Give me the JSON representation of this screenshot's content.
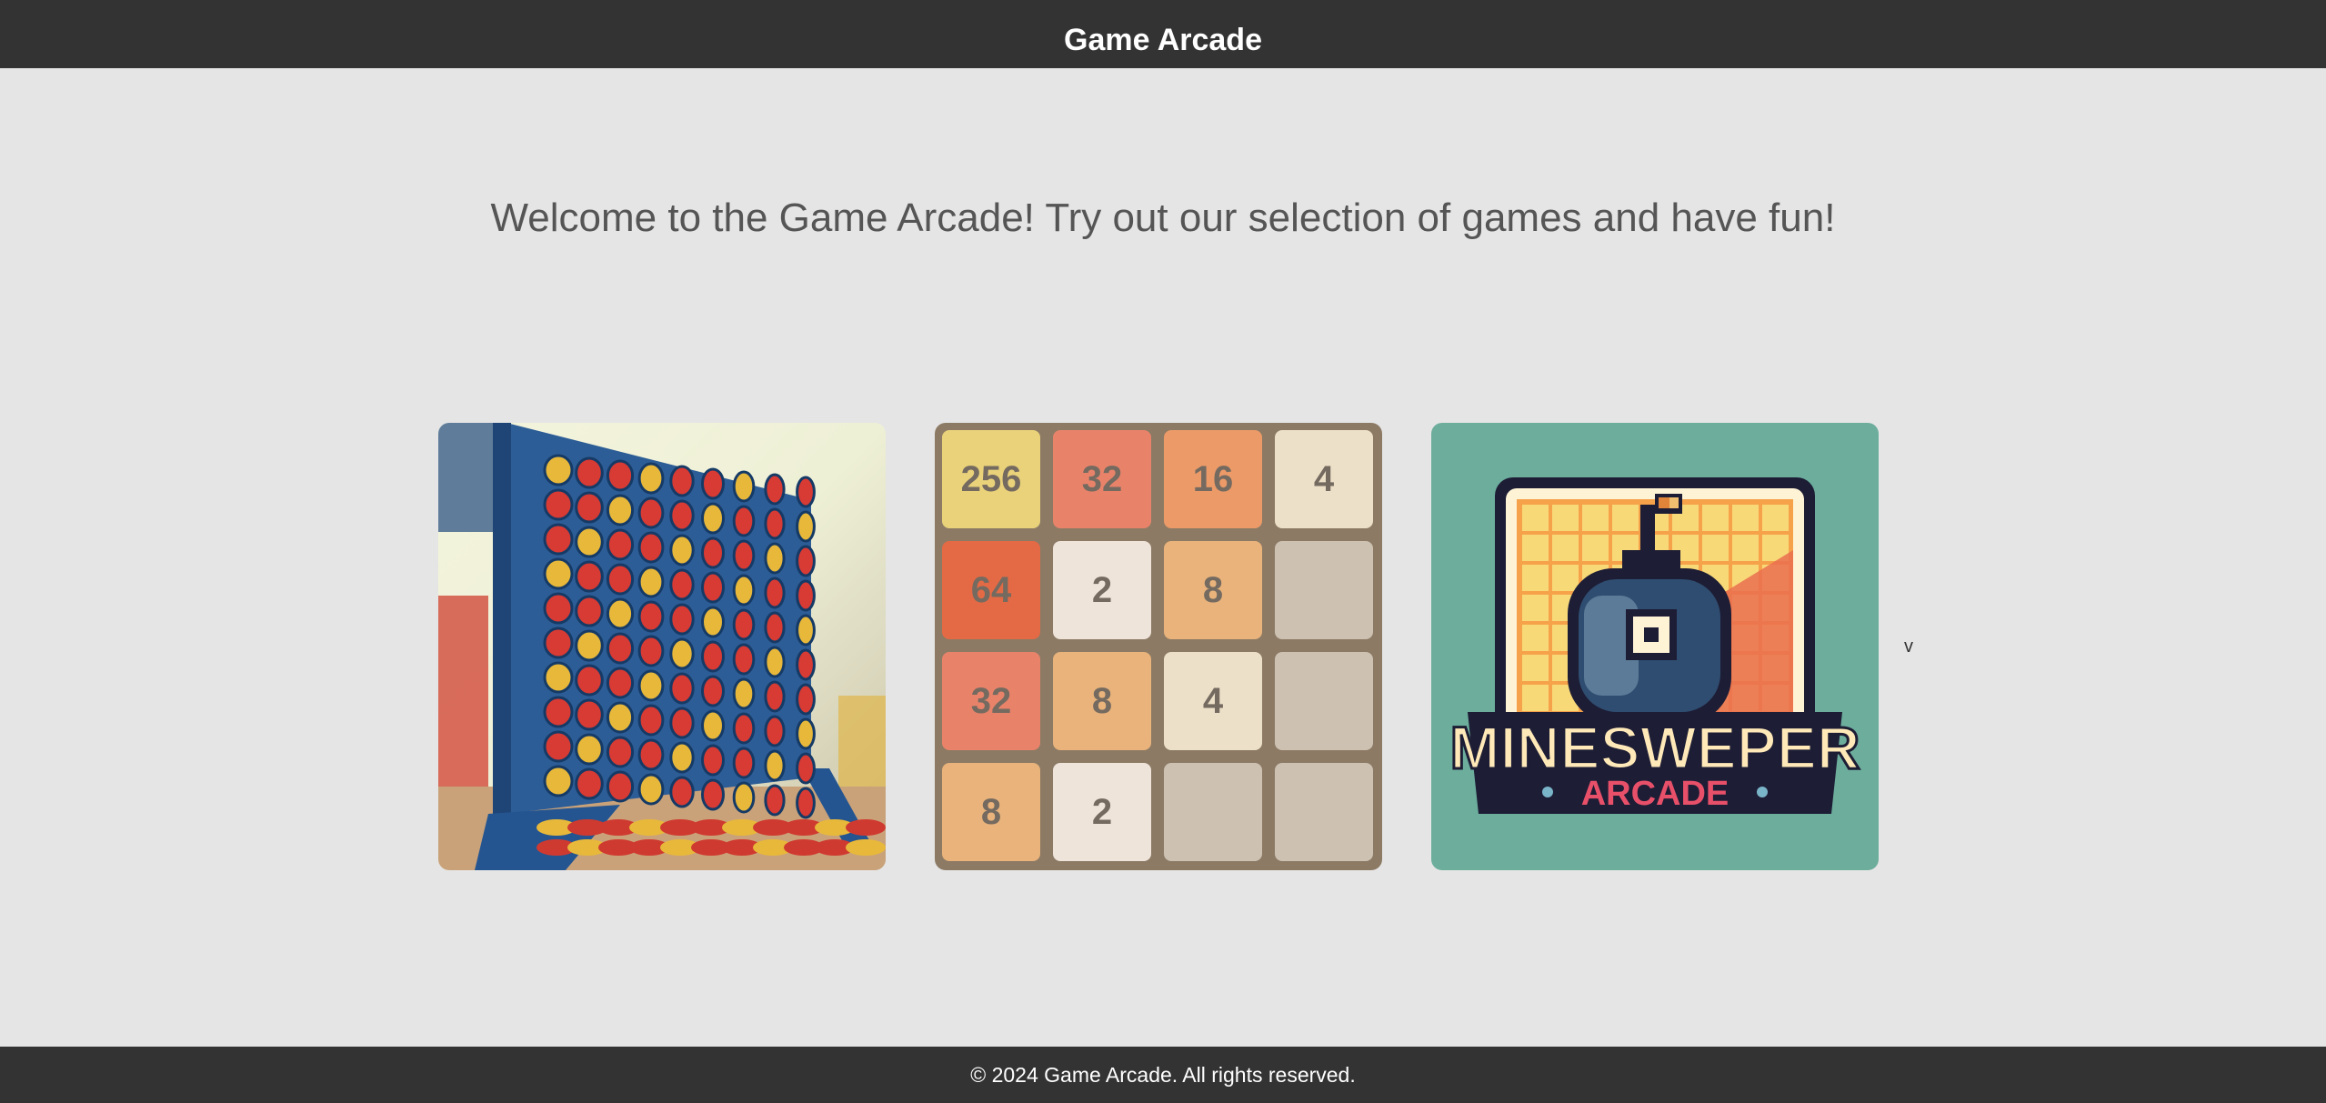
{
  "header": {
    "title": "Game Arcade"
  },
  "main": {
    "welcome": "Welcome to the Game Arcade! Try out our selection of games and have fun!",
    "next_label": "v"
  },
  "games": {
    "connect_four": {
      "icon": "connect-four-board-image"
    },
    "g2048": {
      "icon": "2048-game-board-image",
      "tiles": [
        "256",
        "32",
        "16",
        "4",
        "64",
        "2",
        "8",
        "",
        "32",
        "8",
        "4",
        "",
        "8",
        "2",
        "",
        ""
      ]
    },
    "minesweeper": {
      "icon": "bomb-icon",
      "logo_line1": "MINESWEPER",
      "logo_line2": "ARCADE"
    }
  },
  "colors": {
    "bar": "#333333",
    "background": "#e5e5e5",
    "board2048": "#8c7a64",
    "mine_bg": "#6cad9c"
  },
  "footer": {
    "copyright": "© 2024 Game Arcade. All rights reserved."
  }
}
